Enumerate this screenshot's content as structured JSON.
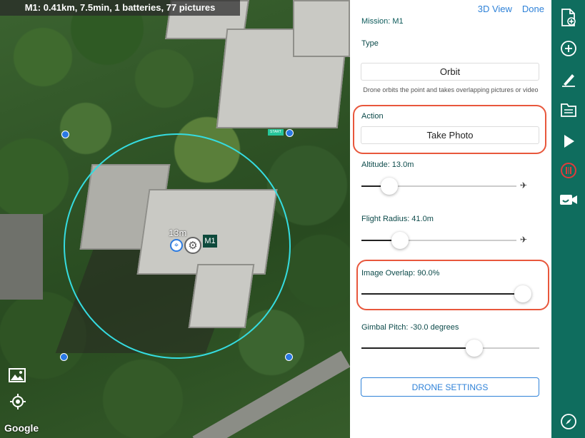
{
  "map": {
    "header": "M1: 0.41km, 7.5min, 1 batteries, 77 pictures",
    "orbit_label": "13m",
    "marker_label": "M1",
    "attribution": "Google",
    "start_tag": "START",
    "icons": [
      "image-icon",
      "locate-icon",
      "orbit-center-icon",
      "gear-icon"
    ]
  },
  "panel": {
    "links": {
      "view3d": "3D View",
      "done": "Done"
    },
    "mission_title": "Mission: M1",
    "type": {
      "label": "Type",
      "value": "Orbit",
      "hint": "Drone orbits the point and takes overlapping pictures or video"
    },
    "action": {
      "label": "Action",
      "value": "Take Photo"
    },
    "sliders": {
      "altitude": {
        "label": "Altitude: 13.0m",
        "fraction": 0.14
      },
      "radius": {
        "label": "Flight Radius: 41.0m",
        "fraction": 0.22
      },
      "overlap": {
        "label": "Image Overlap: 90.0%",
        "fraction": 1.0
      },
      "pitch": {
        "label": "Gimbal Pitch: -30.0 degrees",
        "fraction": 0.65
      }
    },
    "drone_settings": "DRONE SETTINGS"
  },
  "colors": {
    "accent": "#2f82d8",
    "toolbar": "#0f6d5e",
    "orbit": "#35dce0",
    "highlight": "#e8573c",
    "slider_fill": "#222222",
    "slider_track": "#cccccc"
  },
  "toolbar": {
    "icons": [
      "new-file-icon",
      "add-icon",
      "draw-icon",
      "folder-icon",
      "play-icon",
      "stop-icon",
      "video-icon",
      "compass-icon"
    ]
  }
}
